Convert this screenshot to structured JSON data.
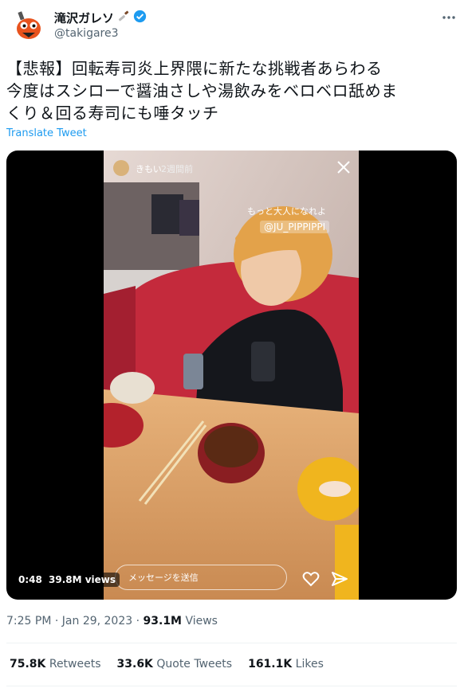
{
  "author": {
    "display_name": "滝沢ガレソ",
    "handle": "@takigare3"
  },
  "tweet": {
    "lines": [
      "【悲報】回転寿司炎上界隈に新たな挑戦者あらわる",
      "今度はスシローで醤油さしや湯飲みをベロベロ舐めま",
      "くり＆回る寿司にも唾タッチ"
    ],
    "translate_label": "Translate Tweet"
  },
  "video": {
    "duration": "0:48",
    "views": "39.8M views",
    "story": {
      "username": "きもい",
      "time_ago": "2週間前",
      "caption": "もっと大人になれよ",
      "mention": "@JU_PIPPIPPI",
      "message_placeholder": "メッセージを送信"
    }
  },
  "meta": {
    "time": "7:25 PM",
    "separator": "·",
    "date": "Jan 29, 2023",
    "views_count": "93.1M",
    "views_label": "Views"
  },
  "stats": {
    "retweets_count": "75.8K",
    "retweets_label": "Retweets",
    "quotes_count": "33.6K",
    "quotes_label": "Quote Tweets",
    "likes_count": "161.1K",
    "likes_label": "Likes"
  },
  "colors": {
    "link": "#1d9bf0",
    "verified": "#1d9bf0",
    "secondary_text": "#536471",
    "divider": "#eff3f4"
  },
  "icons": [
    "more-icon",
    "verified-icon",
    "knife-emoji-icon",
    "heart-icon",
    "send-icon",
    "close-icon"
  ]
}
